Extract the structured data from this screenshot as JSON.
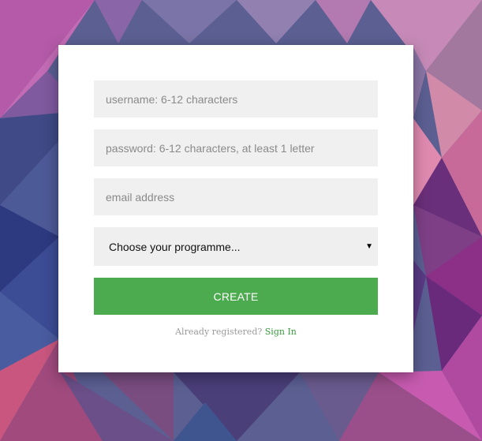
{
  "form": {
    "username_placeholder": "username: 6-12 characters",
    "password_placeholder": "password: 6-12 characters, at least 1 letter",
    "email_placeholder": "email address",
    "programme_select": {
      "selected": "Choose your programme..."
    },
    "create_label": "CREATE",
    "already_registered_text": "Already registered?",
    "sign_in_label": "Sign In"
  },
  "colors": {
    "button": "#4caa4f",
    "field_bg": "#f0f0f0",
    "link": "#3a9a3f"
  }
}
